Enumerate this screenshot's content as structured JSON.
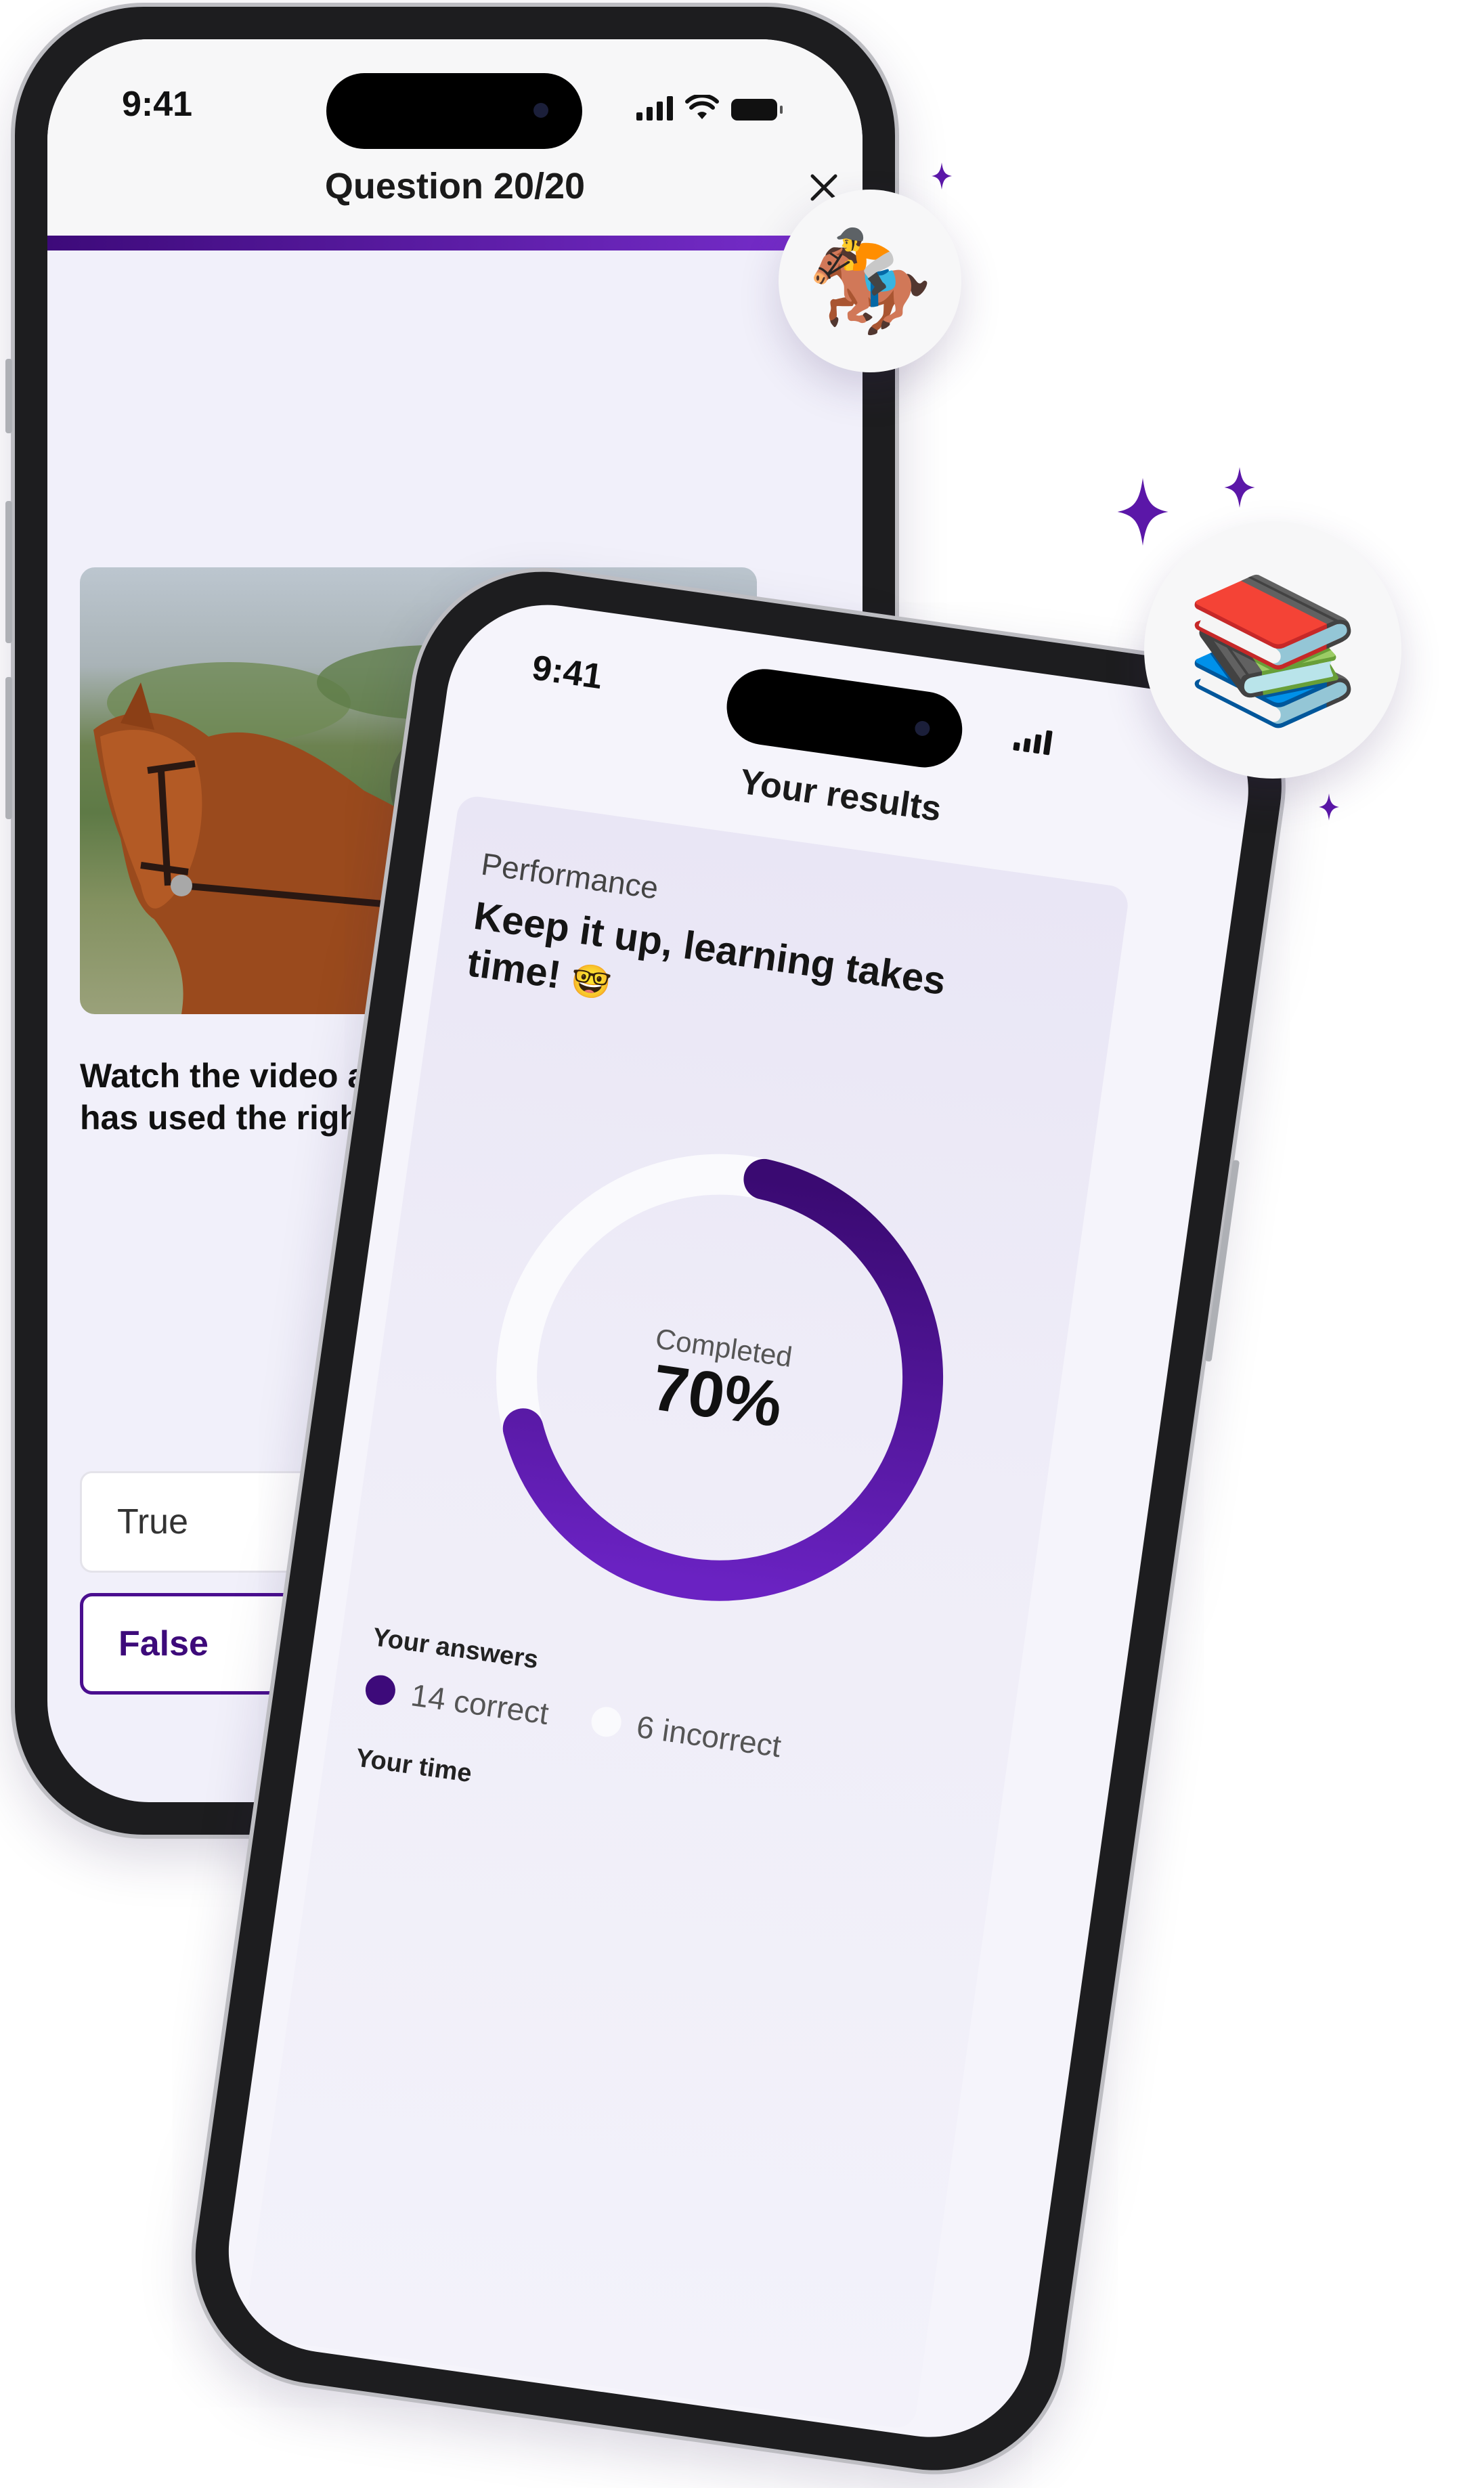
{
  "colors": {
    "accent": "#5b17a8",
    "accent_dark": "#3d0a7a",
    "screen_bg": "#f1f0fa",
    "ring_track": "#fafafd"
  },
  "quiz_phone": {
    "status_time": "9:41",
    "title": "Question 20/20",
    "close_icon": "close-icon",
    "progress": 1.0,
    "video_icon": "play-icon",
    "prompt_line1": "Watch the video and",
    "prompt_line2": "has used the right ai",
    "options": [
      {
        "label": "True",
        "selected": false
      },
      {
        "label": "False",
        "selected": true
      }
    ]
  },
  "results_phone": {
    "status_time": "9:41",
    "title": "Your results",
    "performance_label": "Performance",
    "message_line1": "Keep it up, learning takes",
    "message_line2": "time!",
    "message_emoji": "🤓",
    "completed_label": "Completed",
    "completed_value": "70%",
    "completed_fraction": 0.7,
    "answers_label": "Your answers",
    "correct_text": "14 correct",
    "incorrect_text": "6 incorrect",
    "time_label": "Your time"
  },
  "badges": {
    "horse_emoji": "🏇",
    "books_emoji": "📚"
  }
}
